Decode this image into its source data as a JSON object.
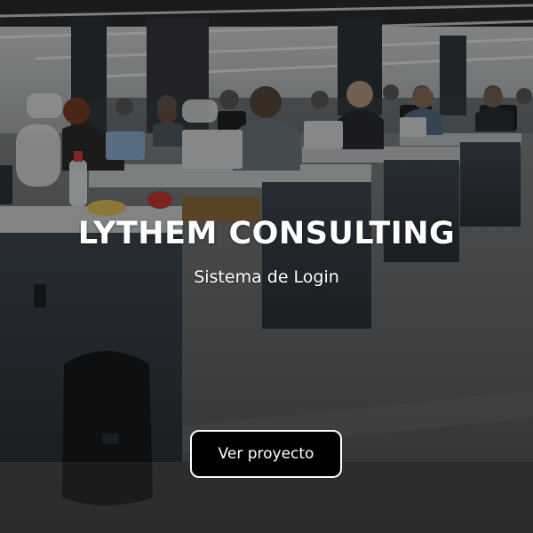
{
  "card": {
    "title": "LYTHEM CONSULTING",
    "subtitle": "Sistema de Login",
    "button_label": "Ver proyecto"
  },
  "colors": {
    "overlay": "#000000",
    "text": "#ffffff",
    "button_bg": "#000000",
    "button_border": "#ffffff"
  }
}
